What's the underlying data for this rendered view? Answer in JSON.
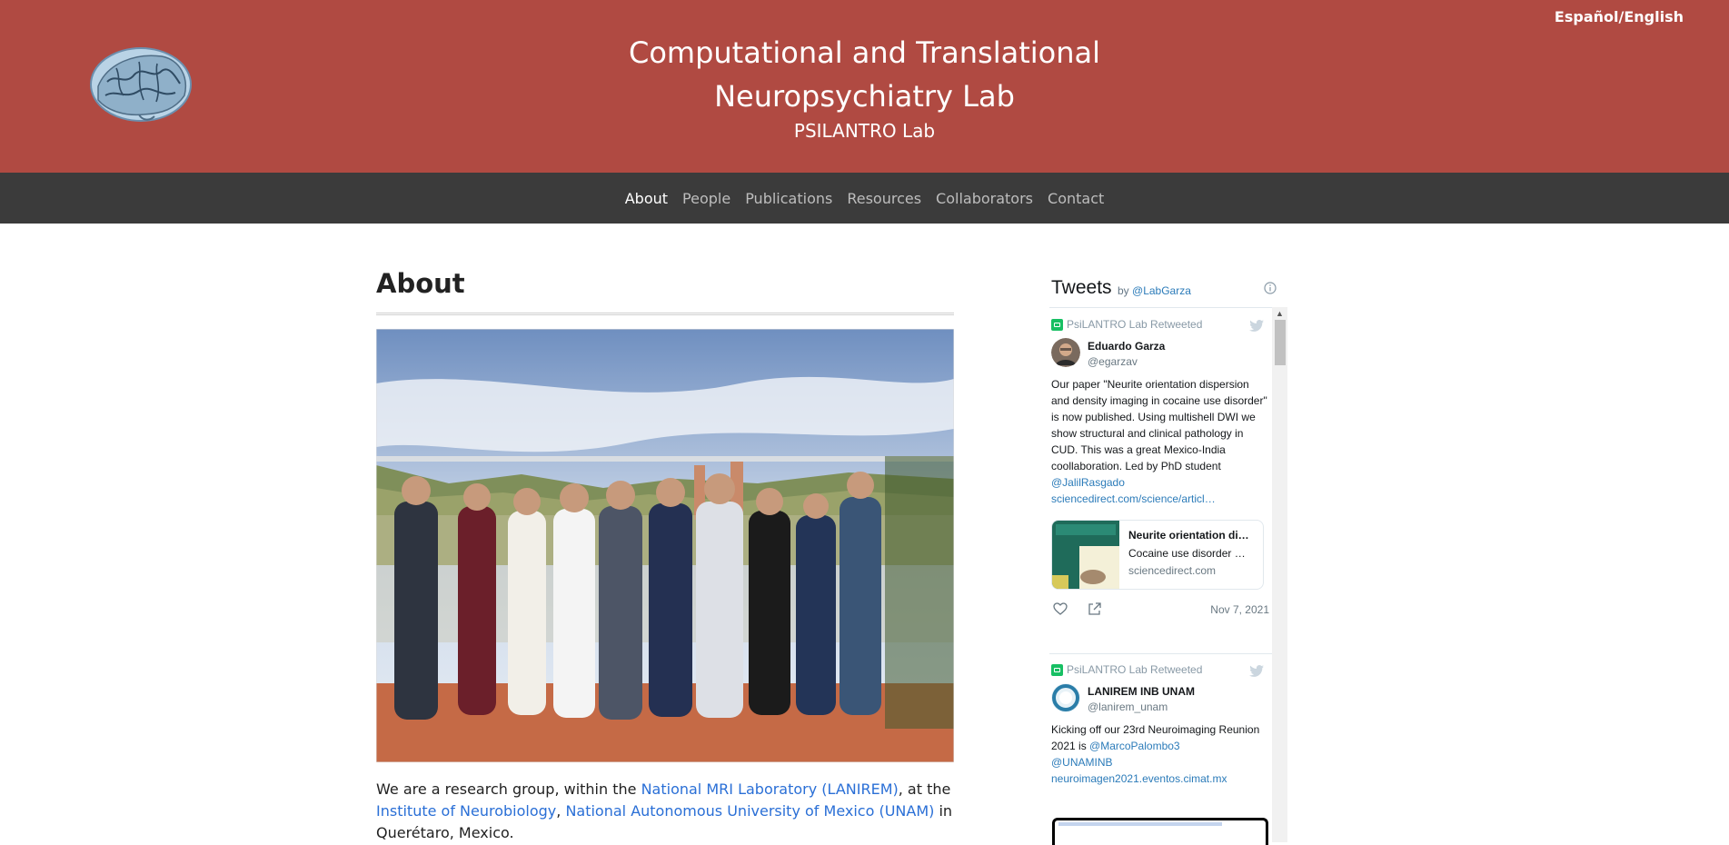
{
  "header": {
    "language_toggle": "Español/English",
    "title_line1": "Computational and Translational",
    "title_line2": "Neuropsychiatry Lab",
    "subtitle": "PSILANTRO Lab",
    "logo_icon": "brain-logo-icon"
  },
  "nav": {
    "items": [
      {
        "label": "About",
        "active": true
      },
      {
        "label": "People",
        "active": false
      },
      {
        "label": "Publications",
        "active": false
      },
      {
        "label": "Resources",
        "active": false
      },
      {
        "label": "Collaborators",
        "active": false
      },
      {
        "label": "Contact",
        "active": false
      }
    ]
  },
  "main": {
    "title": "About",
    "intro": {
      "t1": "We are a research group, within the ",
      "link1": "National MRI Laboratory (LANIREM)",
      "t2": ", at the ",
      "link2": "Institute of Neurobiology",
      "t3": ", ",
      "link3": "National Autonomous University of Mexico (UNAM)",
      "t4": " in Querétaro, Mexico."
    }
  },
  "twitter": {
    "title": "Tweets",
    "by": "by ",
    "by_handle": "@LabGarza",
    "tweets": [
      {
        "retweeted_by": "PsiLANTRO Lab Retweeted",
        "name": "Eduardo Garza",
        "handle": "@egarzav",
        "text": "Our paper \"Neurite orientation dispersion and density imaging in cocaine use disorder\" is now published. Using multishell DWI we show structural and clinical pathology in CUD. This was a great Mexico-India coollaboration. Led by PhD student ",
        "mention": "@JalilRasgado",
        "link": "sciencedirect.com/science/articl…",
        "card_title": "Neurite orientation di…",
        "card_desc": "Cocaine use disorder …",
        "card_domain": "sciencedirect.com",
        "date": "Nov 7, 2021"
      },
      {
        "retweeted_by": "PsiLANTRO Lab Retweeted",
        "name": "LANIREM INB UNAM",
        "handle": "@lanirem_unam",
        "text": "Kicking off our 23rd Neuroimaging Reunion 2021 is ",
        "mention1": "@MarcoPalombo3",
        "mention2": "@UNAMINB",
        "link": "neuroimagen2021.eventos.cimat.mx"
      }
    ]
  },
  "colors": {
    "header_bg": "#b04a42",
    "nav_bg": "#3b3b3b",
    "link": "#2a6fd6"
  }
}
